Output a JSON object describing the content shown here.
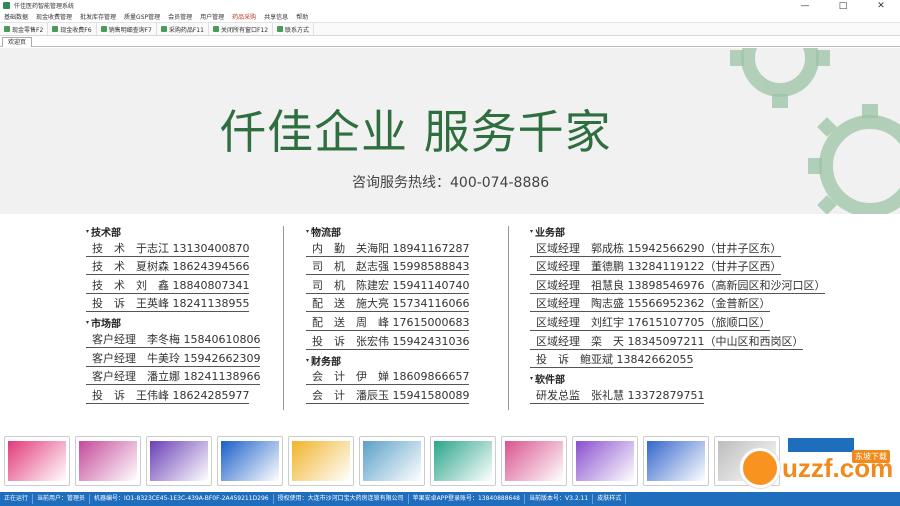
{
  "window": {
    "title": "仟佳医药智能管理系统",
    "controls": [
      "—",
      "□",
      "✕"
    ]
  },
  "menu": [
    "基础数据",
    "现金收费管理",
    "批发库存管理",
    "质量GSP管理",
    "会员管理",
    "用户管理",
    "药品采购",
    "共享信息",
    "帮助"
  ],
  "toolbar": [
    "现金零售F2",
    "现金收费F6",
    "销售明细查询F7",
    "采购药品F11",
    "关闭所有窗口F12",
    "联系方式"
  ],
  "tab": "欢迎页",
  "banner": {
    "slogan": "仟佳企业 服务千家",
    "hotline": "咨询服务热线：400-074-8886"
  },
  "columns": [
    {
      "sections": [
        {
          "title": "技术部",
          "entries": [
            "技　术　于志江 13130400870",
            "技　术　夏树森 18624394566",
            "技　术　刘　鑫 18840807341",
            "投　诉　王英峰 18241138955"
          ]
        },
        {
          "title": "市场部",
          "entries": [
            "客户经理　李冬梅 15840610806",
            "客户经理　牛美玲 15942662309",
            "客户经理　潘立娜 18241138966",
            "投　诉　王伟峰 18624285977"
          ]
        }
      ]
    },
    {
      "sections": [
        {
          "title": "物流部",
          "entries": [
            "内　勤　关海阳 18941167287",
            "司　机　赵志强 15998588843",
            "司　机　陈建宏 15941140740",
            "配　送　施大亮 15734116066",
            "配　送　周　峰 17615000683",
            "投　诉　张宏伟 15942431036"
          ]
        },
        {
          "title": "财务部",
          "entries": [
            "会　计　伊　婵 18609866657",
            "会　计　潘辰玉 15941580089"
          ]
        }
      ]
    },
    {
      "sections": [
        {
          "title": "业务部",
          "entries": [
            "区域经理　郭成栋 15942566290（甘井子区东）",
            "区域经理　董德鹏 13284119122（甘井子区西）",
            "区域经理　祖慧良 13898546976（高新园区和沙河口区）",
            "区域经理　陶志盛 15566952362（金普新区）",
            "区域经理　刘红宇 17615107705（旅顺口区）",
            "区域经理　栾　天 18345097211（中山区和西岗区）",
            "投　诉　鲍亚斌 13842662055"
          ]
        },
        {
          "title": "软件部",
          "entries": [
            "研发总监　张礼慧 13372879751"
          ]
        }
      ]
    }
  ],
  "thumbnails": [
    {
      "name": "promo-1",
      "color": "#e23a7a"
    },
    {
      "name": "promo-2",
      "color": "#c44a9a"
    },
    {
      "name": "promo-3",
      "color": "#6a3fb5"
    },
    {
      "name": "promo-4",
      "color": "#1a5fc8"
    },
    {
      "name": "promo-5",
      "color": "#f0b429"
    },
    {
      "name": "promo-6",
      "color": "#5aa0c8"
    },
    {
      "name": "promo-7",
      "color": "#2aa58a"
    },
    {
      "name": "promo-8",
      "color": "#d9548f"
    },
    {
      "name": "promo-9",
      "color": "#8a4fd0"
    },
    {
      "name": "promo-10",
      "color": "#3366cc"
    },
    {
      "name": "promo-11",
      "color": "#bcbcbc"
    }
  ],
  "watermark": {
    "text": "uzzf.com",
    "badge": "东坡下载"
  },
  "status": [
    "正在运行",
    "当前用户：管理员",
    "机器编号：IO1-8323CE45-1E3C-439A-BF0F-2A459211D296",
    "授权使用：大连市沙河口宝大药房连锁有限公司",
    "苹果安卓APP登录账号：13840888648",
    "当前版本号：V3.2.11",
    "皮肤样式"
  ],
  "colors": {
    "brand": "#2f6e3f",
    "status_bar": "#1f6dbd",
    "gear": "#9cc4a6"
  }
}
